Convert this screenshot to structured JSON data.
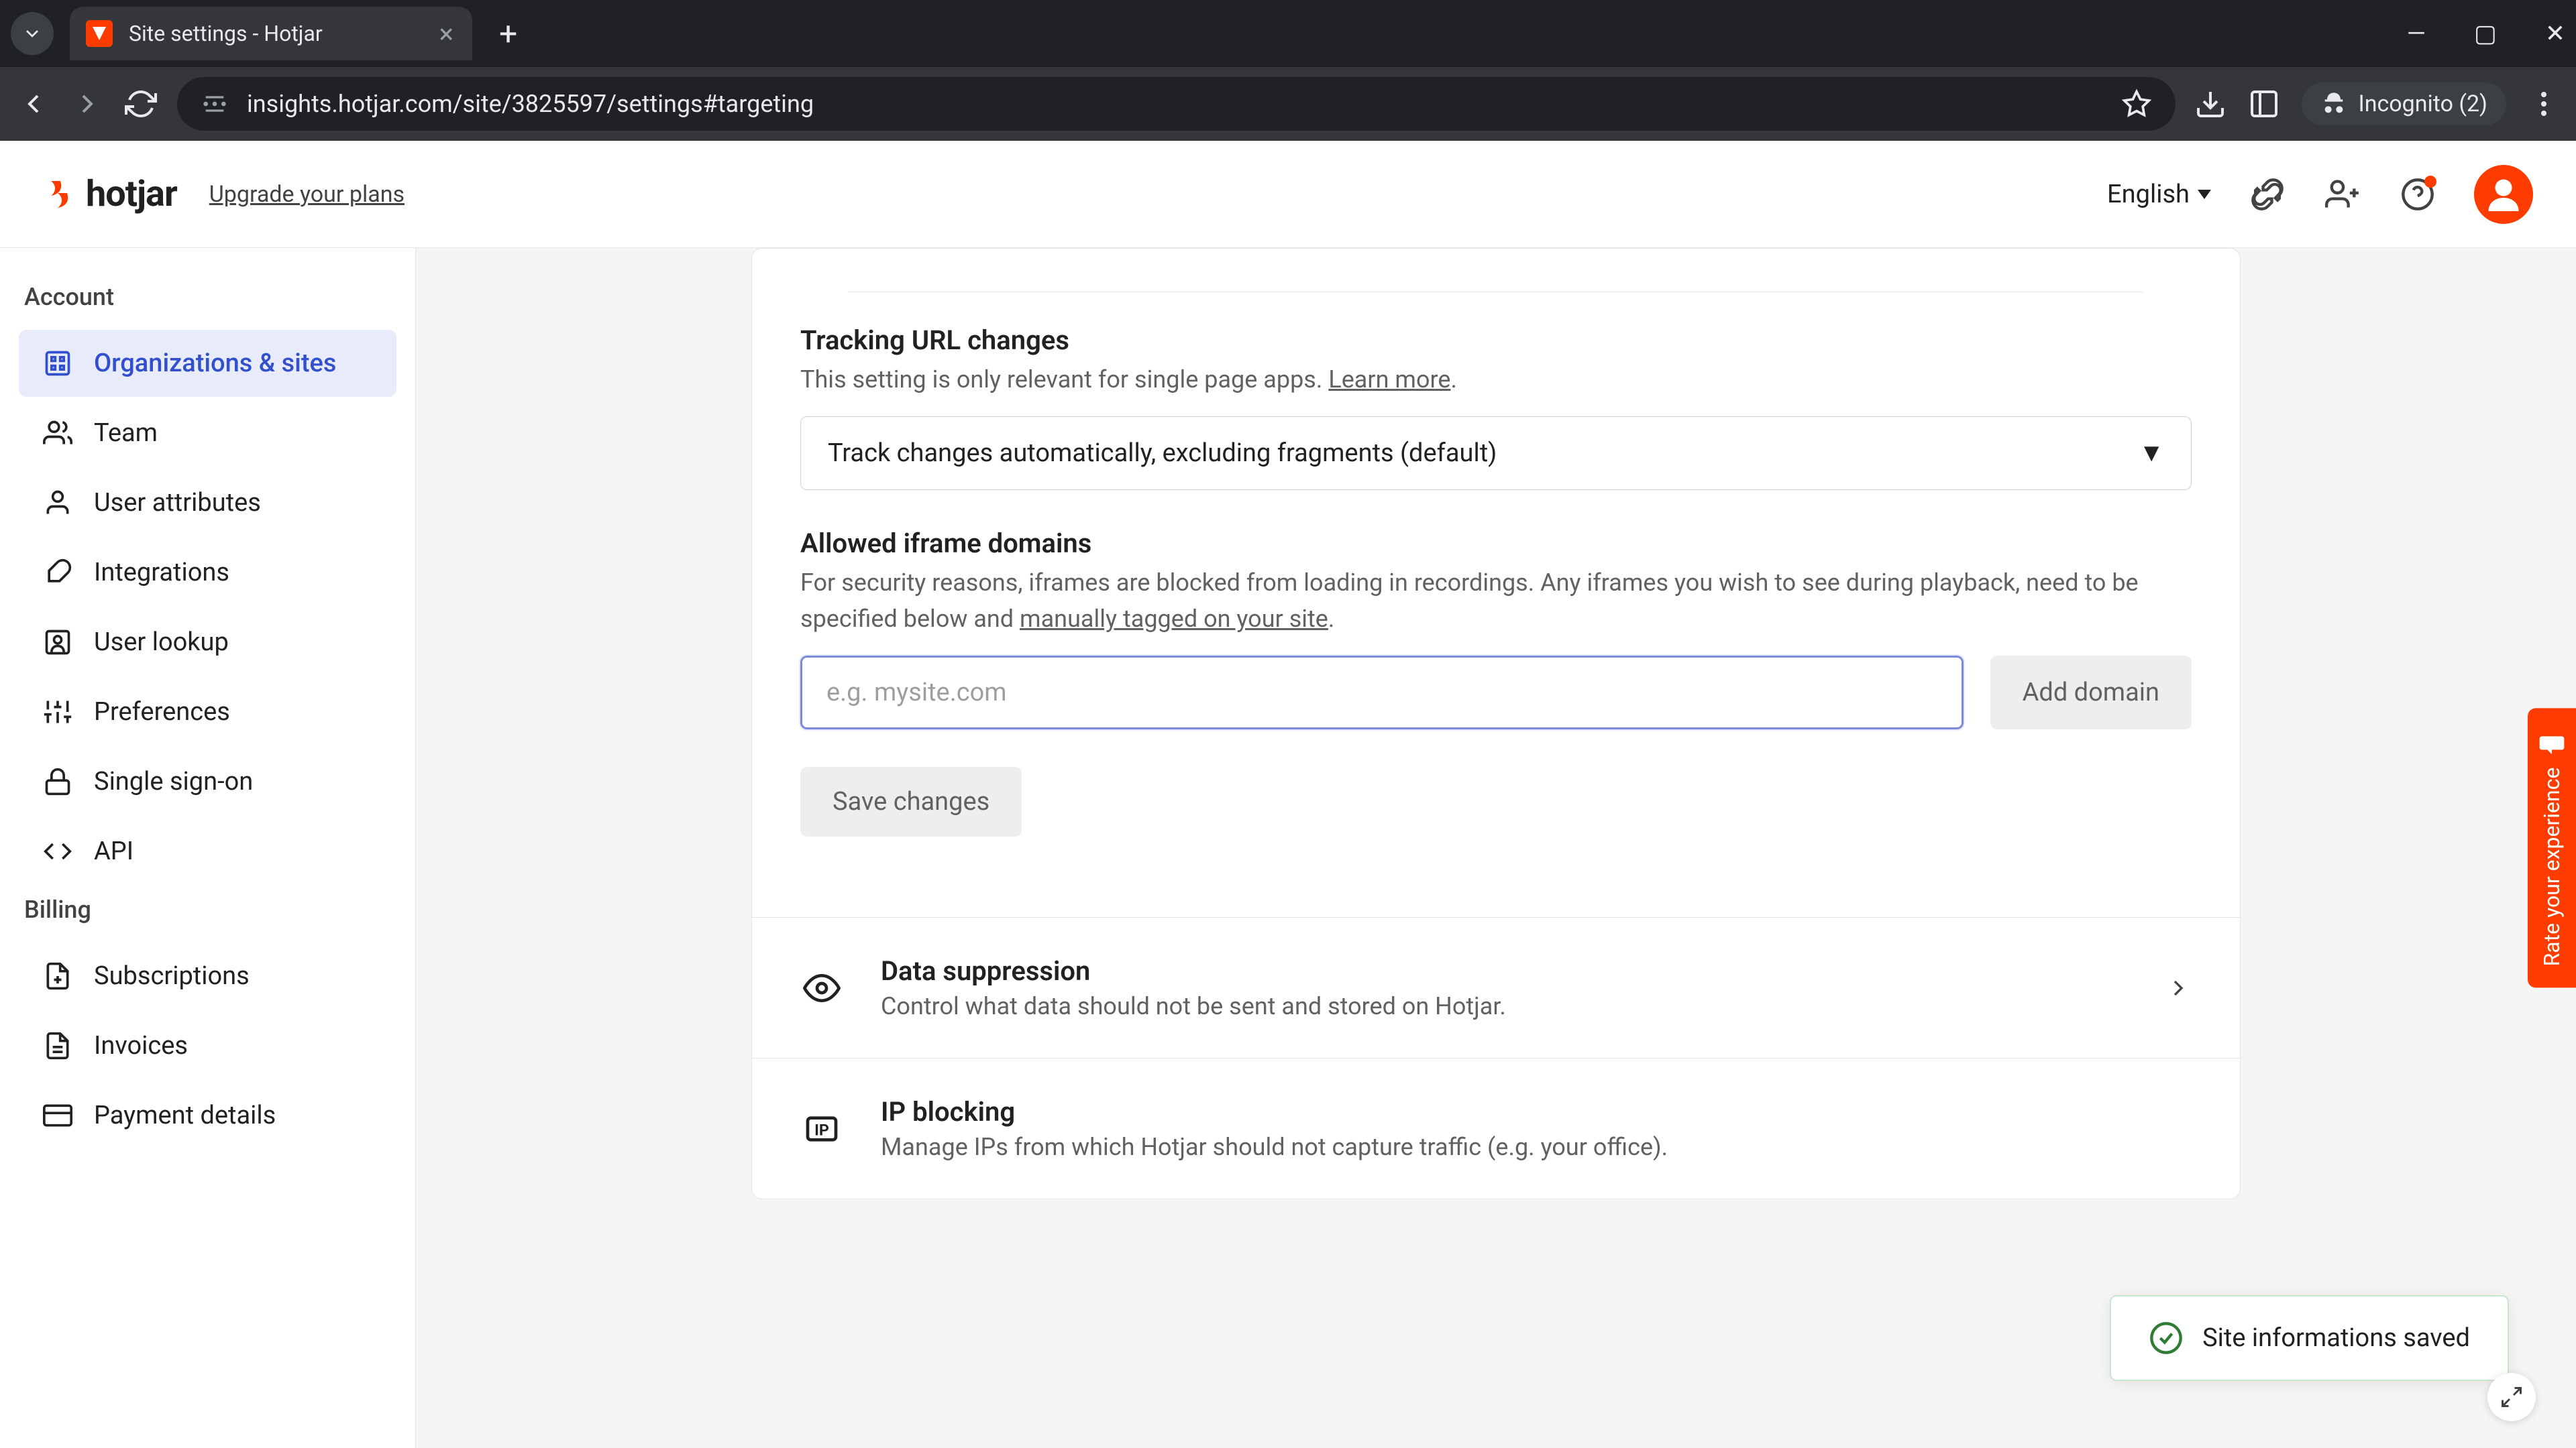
{
  "browser": {
    "tab_title": "Site settings - Hotjar",
    "url": "insights.hotjar.com/site/3825597/settings#targeting",
    "incognito_label": "Incognito (2)"
  },
  "header": {
    "logo_text": "hotjar",
    "upgrade": "Upgrade your plans",
    "language": "English"
  },
  "sidebar": {
    "section_account": "Account",
    "section_billing": "Billing",
    "items_account": [
      {
        "label": "Organizations & sites",
        "active": true
      },
      {
        "label": "Team"
      },
      {
        "label": "User attributes"
      },
      {
        "label": "Integrations"
      },
      {
        "label": "User lookup"
      },
      {
        "label": "Preferences"
      },
      {
        "label": "Single sign-on"
      },
      {
        "label": "API"
      }
    ],
    "items_billing": [
      {
        "label": "Subscriptions"
      },
      {
        "label": "Invoices"
      },
      {
        "label": "Payment details"
      }
    ]
  },
  "main": {
    "tracking": {
      "title": "Tracking URL changes",
      "desc_prefix": "This setting is only relevant for single page apps. ",
      "learn_more": "Learn more",
      "select_value": "Track changes automatically, excluding fragments (default)"
    },
    "iframe": {
      "title": "Allowed iframe domains",
      "desc_prefix": "For security reasons, iframes are blocked from loading in recordings. Any iframes you wish to see during playback, need to be specified below and ",
      "tag_link": "manually tagged on your site",
      "placeholder": "e.g. mysite.com",
      "add_btn": "Add domain",
      "save_btn": "Save changes"
    },
    "data_suppression": {
      "title": "Data suppression",
      "desc": "Control what data should not be sent and stored on Hotjar."
    },
    "ip_blocking": {
      "title": "IP blocking",
      "desc": "Manage IPs from which Hotjar should not capture traffic (e.g. your office)."
    }
  },
  "toast": {
    "message": "Site informations saved"
  },
  "feedback": {
    "label": "Rate your experience"
  }
}
